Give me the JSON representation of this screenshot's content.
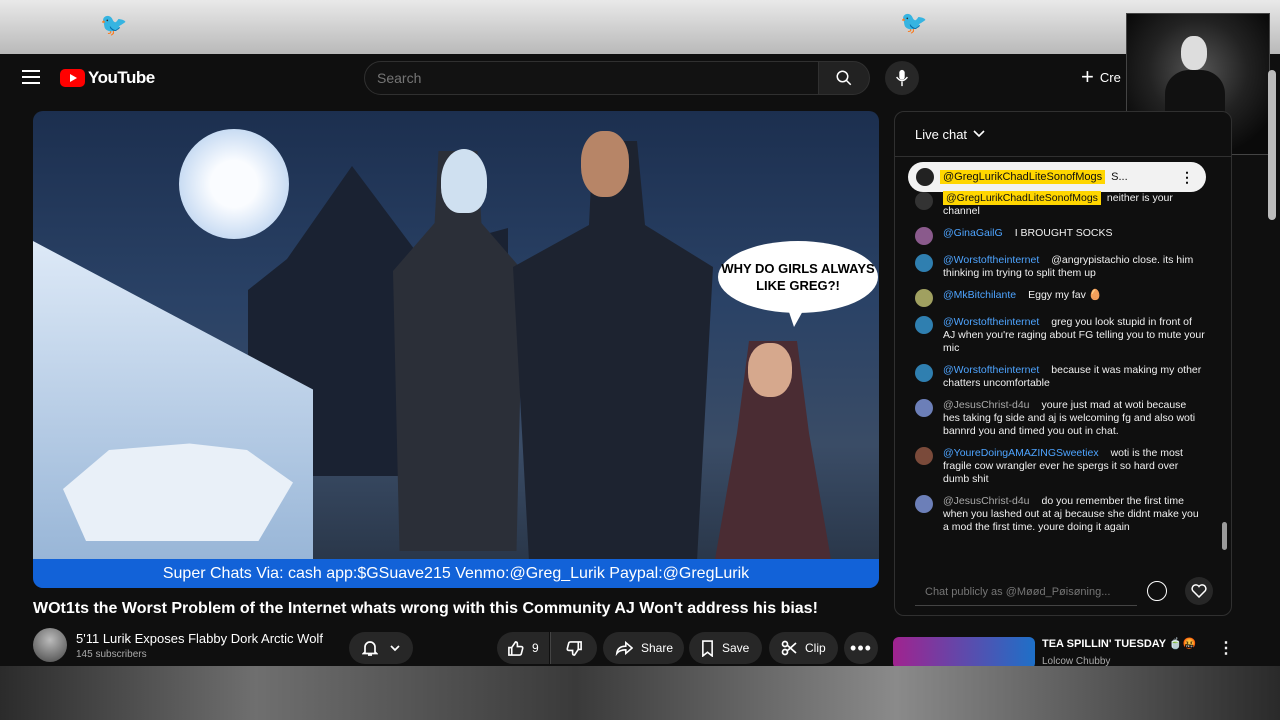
{
  "header": {
    "logo_text": "YouTube",
    "search_placeholder": "Search",
    "create_label": "Cre"
  },
  "video": {
    "bubble_text": "WHY DO GIRLS ALWAYS LIKE GREG?!",
    "banner_text": "Super Chats Via: cash app:$GSuave215 Venmo:@Greg_Lurik Paypal:@GregLurik",
    "title": "WOt1ts the Worst Problem of the Internet whats wrong with this Community AJ Won't address his bias!",
    "channel_name": "5'11 Lurik Exposes Flabby Dork Arctic Wolf",
    "subscribers": "145 subscribers",
    "like_count": "9",
    "share_label": "Share",
    "save_label": "Save",
    "clip_label": "Clip"
  },
  "chat": {
    "header_label": "Live chat",
    "pinned": {
      "author": "@GregLurikChadLiteSonofMogs",
      "text": "S..."
    },
    "messages": [
      {
        "author": "@GregLurikChadLiteSonofMogs",
        "text": "neither is your channel",
        "avatar_color": "#333333"
      },
      {
        "author": "@GinaGailG",
        "text": "I BROUGHT SOCKS",
        "avatar_color": "#8a5a8c"
      },
      {
        "author": "@Worstoftheinternet",
        "text": "@angrypistachio close. its him thinking im trying to split them up",
        "avatar_color": "#2f7fb0"
      },
      {
        "author": "@MkBitchilante",
        "text": "Eggy my fav 🥚",
        "avatar_color": "#a0a060"
      },
      {
        "author": "@Worstoftheinternet",
        "text": "greg you look stupid in front of AJ when you're raging about FG telling you to mute your mic",
        "avatar_color": "#2f7fb0"
      },
      {
        "author": "@Worstoftheinternet",
        "text": "because it was making my other chatters uncomfortable",
        "avatar_color": "#2f7fb0"
      },
      {
        "author": "@JesusChrist-d4u",
        "text": "youre just mad at woti because hes taking fg side and aj is welcoming fg and also woti bannrd you and timed you out in chat.",
        "avatar_color": "#6c7fb8"
      },
      {
        "author": "@YoureDoingAMAZINGSweetiex",
        "text": "woti is the most fragile cow wrangler ever he spergs it so hard over dumb shit",
        "avatar_color": "#7a4a3a"
      },
      {
        "author": "@JesusChrist-d4u",
        "text": "do you remember the first time when you lashed out at aj because she didnt make you a mod the first time. youre doing it again",
        "avatar_color": "#6c7fb8"
      }
    ],
    "input_placeholder": "Chat publicly as @Møød_Pøisøning..."
  },
  "recommendation": {
    "title": "TEA SPILLIN' TUESDAY 🍵🤬",
    "channel": "Lolcow Chubby"
  },
  "colors": {
    "accent_red": "#ff0000",
    "banner_blue": "#1262d8",
    "link_blue": "#4ea4ff",
    "highlight_yellow": "#ffd600"
  }
}
